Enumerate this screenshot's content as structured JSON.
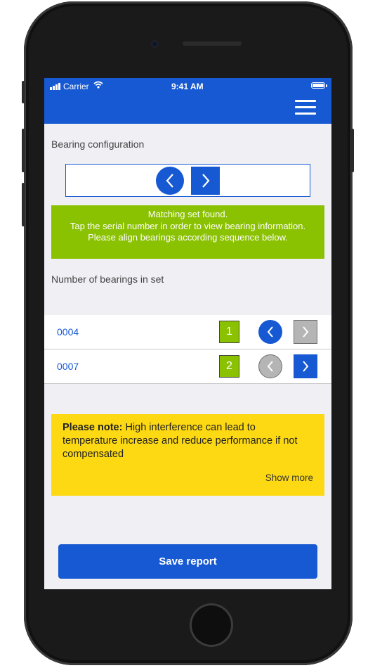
{
  "status_bar": {
    "carrier": "Carrier",
    "time": "9:41 AM"
  },
  "header": {
    "menu_icon": "hamburger-menu-icon"
  },
  "bearing_configuration": {
    "label": "Bearing configuration",
    "prev_icon": "chevron-left-icon",
    "next_icon": "chevron-right-icon"
  },
  "match_message": {
    "line1": "Matching set found.",
    "line2": "Tap the serial number in order to view bearing information. Please align bearings according sequence below."
  },
  "bearings_section": {
    "label": "Number of bearings in set",
    "rows": [
      {
        "serial": "0004",
        "position": "1",
        "prev_enabled": true,
        "next_enabled": false
      },
      {
        "serial": "0007",
        "position": "2",
        "prev_enabled": false,
        "next_enabled": true
      }
    ]
  },
  "note": {
    "title": "Please note:",
    "text": "High interference can lead to temperature increase and reduce performance if not compensated",
    "show_more": "Show more"
  },
  "actions": {
    "save_label": "Save report"
  },
  "colors": {
    "primary": "#1659d3",
    "success": "#8ac100",
    "warning": "#fdd914",
    "disabled": "#b5b5b5"
  }
}
